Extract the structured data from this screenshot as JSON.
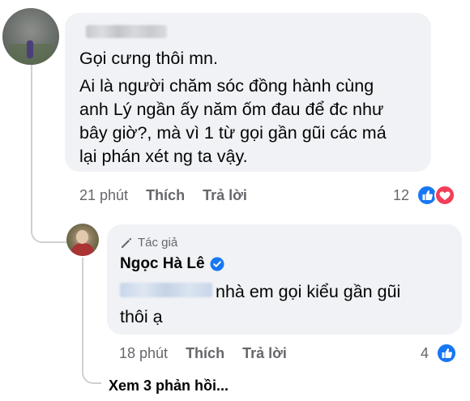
{
  "comment": {
    "text_lines": [
      "Gọi cưng thôi mn.",
      "Ai là người chăm sóc đồng hành cùng",
      "anh Lý ngần ấy năm ốm đau để đc như",
      "bây giờ?, mà vì 1 từ gọi gần gũi các má",
      "lại phán xét ng ta vậy."
    ],
    "time": "21 phút",
    "like_label": "Thích",
    "reply_label": "Trả lời",
    "reaction_count": "12",
    "reaction_icons": [
      "like-icon",
      "love-icon"
    ],
    "colors": {
      "like": "#1877f2",
      "love": "#f33e58"
    }
  },
  "reply": {
    "badge": "Tác giả",
    "author": "Ngọc Hà Lê",
    "verified": true,
    "text_line_1": "nhà em gọi kiểu gần gũi",
    "text_line_2": "thôi ạ",
    "time": "18 phút",
    "like_label": "Thích",
    "reply_label": "Trả lời",
    "reaction_count": "4",
    "reaction_icons": [
      "like-icon"
    ]
  },
  "see_replies": "Xem 3 phản hồi..."
}
